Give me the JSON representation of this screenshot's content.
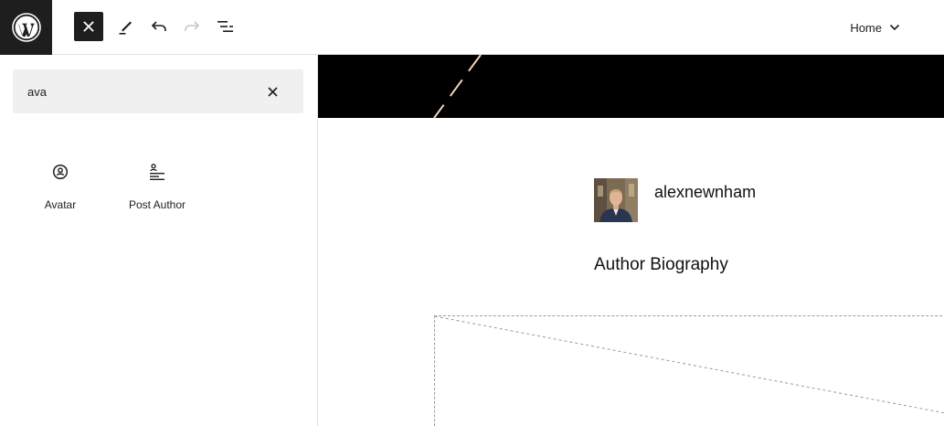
{
  "topbar": {
    "logo_icon": "wordpress-logo-icon",
    "close_icon": "close-icon",
    "tools_icon": "pencil-icon",
    "undo_icon": "undo-icon",
    "redo_icon": "redo-icon",
    "list_view_icon": "list-view-icon",
    "document_title": "Home",
    "document_chevron": "chevron-down-icon"
  },
  "inserter": {
    "search": {
      "value": "ava",
      "placeholder": ""
    },
    "results": [
      {
        "label": "Avatar",
        "icon": "avatar-icon"
      },
      {
        "label": "Post Author",
        "icon": "post-author-icon"
      }
    ]
  },
  "canvas": {
    "author_name": "alexnewnham",
    "author_bio": "Author Biography",
    "header_color": "#000000"
  }
}
